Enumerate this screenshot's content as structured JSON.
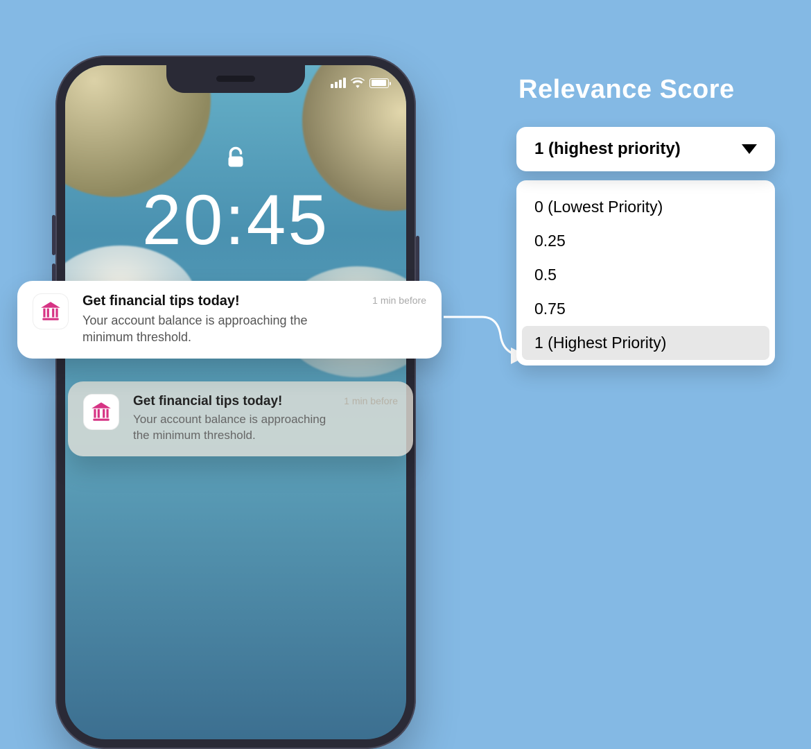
{
  "lockscreen": {
    "time": "20:45"
  },
  "notification": {
    "title": "Get financial tips today!",
    "body": "Your account balance is approaching the minimum threshold.",
    "time": "1 min before"
  },
  "panel": {
    "title": "Relevance Score",
    "selected_label": "1 (highest priority)",
    "options": [
      "0 (Lowest Priority)",
      "0.25",
      "0.5",
      "0.75",
      "1 (Highest Priority)"
    ],
    "selected_index": 4
  }
}
